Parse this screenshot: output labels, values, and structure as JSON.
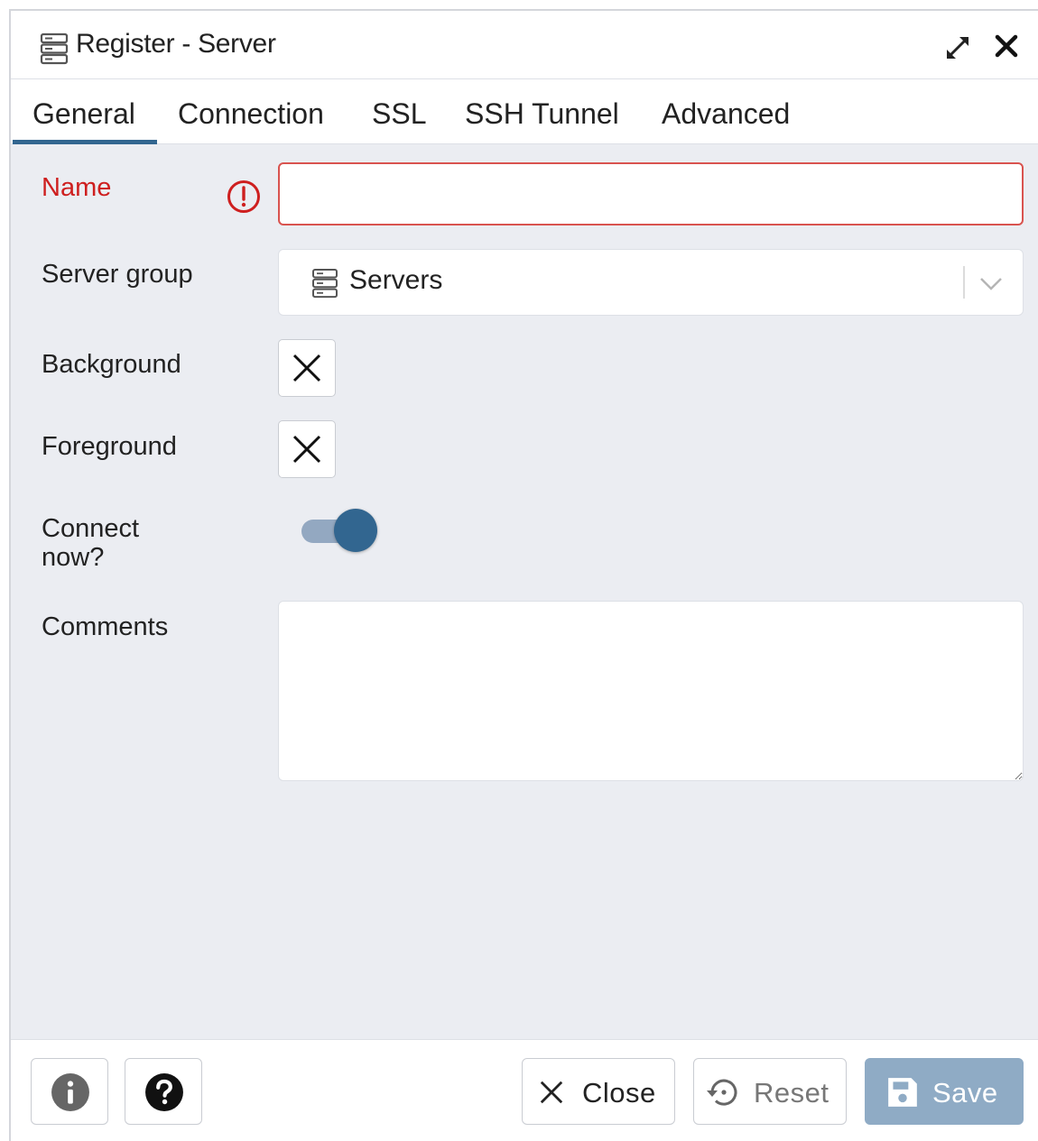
{
  "dialog": {
    "title": "Register - Server",
    "title_icon": "server-icon",
    "expand_icon": "expand-icon",
    "close_icon": "close-icon"
  },
  "tabs": [
    {
      "label": "General",
      "active": true
    },
    {
      "label": "Connection",
      "active": false
    },
    {
      "label": "SSL",
      "active": false
    },
    {
      "label": "SSH Tunnel",
      "active": false
    },
    {
      "label": "Advanced",
      "active": false
    }
  ],
  "form": {
    "name": {
      "label": "Name",
      "value": "",
      "state": "error"
    },
    "server_group": {
      "label": "Server group",
      "value": "Servers",
      "icon": "server-icon"
    },
    "background": {
      "label": "Background",
      "value": "none"
    },
    "foreground": {
      "label": "Foreground",
      "value": "none"
    },
    "connect_now": {
      "label_line1": "Connect",
      "label_line2": "now?",
      "checked": true
    },
    "comments": {
      "label": "Comments",
      "value": ""
    }
  },
  "footer": {
    "info_icon": "info-icon",
    "help_icon": "help-icon",
    "close_label": "Close",
    "reset_label": "Reset",
    "save_label": "Save"
  },
  "colors": {
    "accent": "#326690",
    "error": "#ce1f1f",
    "save_disabled": "#8fabc5",
    "background": "#ebedf2"
  }
}
